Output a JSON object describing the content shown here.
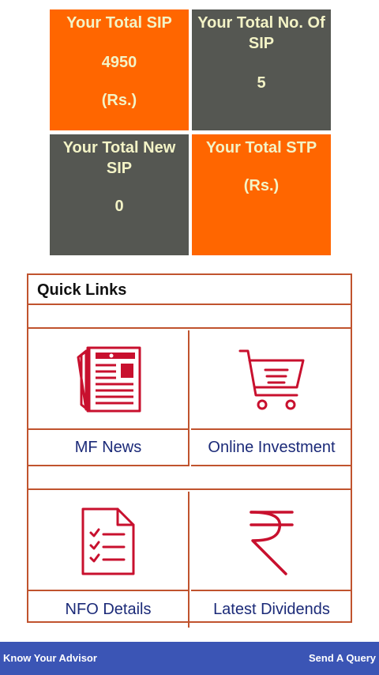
{
  "stats": {
    "total_sip": {
      "title": "Your Total SIP",
      "value": "4950",
      "unit": "(Rs.)"
    },
    "total_no_sip": {
      "title_line1": "Your Total No. Of",
      "title_line2": "SIP",
      "value": "5"
    },
    "total_new_sip": {
      "title_line1": "Your Total New",
      "title_line2": "SIP",
      "value": "0"
    },
    "total_stp": {
      "title": "Your Total STP",
      "unit": "(Rs.)"
    }
  },
  "quick_links": {
    "header": "Quick Links",
    "items": [
      {
        "label": "MF News",
        "icon": "newspaper-icon"
      },
      {
        "label": "Online Investment",
        "icon": "shopping-cart-icon"
      },
      {
        "label": "NFO Details",
        "icon": "checklist-document-icon"
      },
      {
        "label": "Latest Dividends",
        "icon": "rupee-icon"
      }
    ]
  },
  "footer": {
    "left": "Know Your Advisor",
    "right": "Send A Query"
  },
  "colors": {
    "orange": "#ff6600",
    "grey": "#555752",
    "tile_text": "#f3f3c6",
    "icon_red": "#c8102e",
    "link_blue": "#1b2a78",
    "footer_blue": "#3b55b5"
  }
}
